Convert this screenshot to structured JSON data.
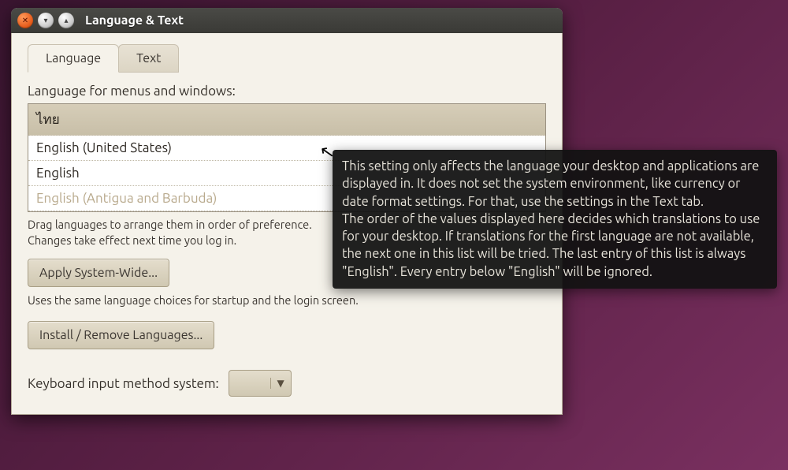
{
  "window": {
    "title": "Language & Text"
  },
  "tabs": {
    "language": "Language",
    "text": "Text"
  },
  "section": {
    "heading": "Language for menus and windows:",
    "items": [
      "ไทย",
      "English (United States)",
      "English",
      "English (Antigua and Barbuda)"
    ],
    "drag_hint": "Drag languages to arrange them in order of preference.\nChanges take effect next time you log in.",
    "apply_btn": "Apply System-Wide...",
    "apply_desc": "Uses the same language choices for startup and the login screen.",
    "install_btn": "Install / Remove Languages...",
    "keyboard_label": "Keyboard input method system:",
    "keyboard_value": ""
  },
  "tooltip": "This setting only affects the language your desktop and applications are displayed in. It does not set the system environment, like currency or date format settings. For that, use the settings in the Text tab.\nThe order of the values displayed here decides which translations to use for your desktop. If translations for the first language are not available, the next one in this list will be tried. The last entry of this list is always \"English\". Every entry below \"English\" will be ignored."
}
